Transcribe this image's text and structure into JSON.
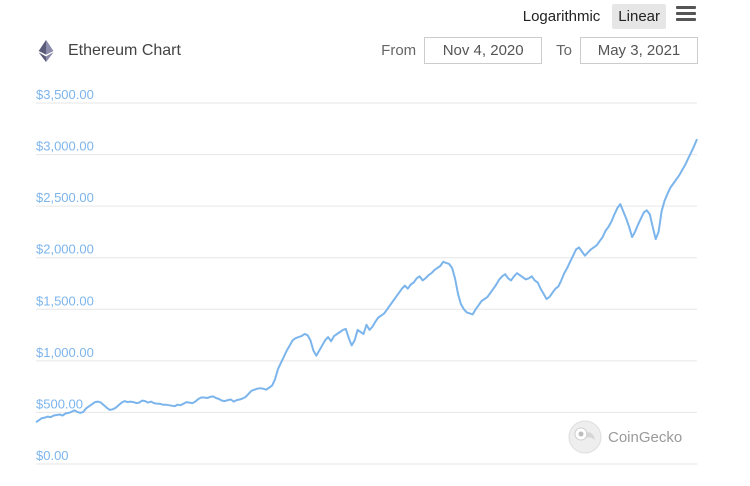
{
  "toolbar": {
    "logarithmic_label": "Logarithmic",
    "linear_label": "Linear",
    "active_scale": "Linear",
    "menu_icon": "hamburger-menu-icon"
  },
  "header": {
    "title": "Ethereum Chart",
    "icon": "ethereum-icon"
  },
  "range": {
    "from_label": "From",
    "from_value": "Nov 4, 2020",
    "to_label": "To",
    "to_value": "May 3, 2021"
  },
  "watermark": {
    "text": "CoinGecko",
    "icon": "coingecko-icon"
  },
  "colors": {
    "line": "#7cb5ec",
    "axis_text": "#7cb5ec",
    "grid": "#e6e6e6"
  },
  "chart_data": {
    "type": "line",
    "title": "Ethereum Chart",
    "xlabel": "",
    "ylabel": "",
    "ylim": [
      0,
      3500
    ],
    "yticks": [
      0,
      500,
      1000,
      1500,
      2000,
      2500,
      3000,
      3500
    ],
    "ytick_labels": [
      "$0.00",
      "$500.00",
      "$1,000.00",
      "$1,500.00",
      "$2,000.00",
      "$2,500.00",
      "$3,000.00",
      "$3,500.00"
    ],
    "grid": true,
    "x_start": "2020-11-04",
    "x_end": "2021-05-03",
    "series": [
      {
        "values": [
          405,
          425,
          445,
          450,
          460,
          455,
          470,
          475,
          480,
          470,
          490,
          495,
          505,
          520,
          505,
          495,
          505,
          540,
          560,
          580,
          600,
          605,
          595,
          570,
          545,
          525,
          530,
          545,
          570,
          595,
          610,
          600,
          605,
          600,
          590,
          595,
          615,
          610,
          595,
          605,
          590,
          585,
          585,
          575,
          575,
          570,
          565,
          560,
          575,
          570,
          585,
          600,
          595,
          590,
          605,
          630,
          645,
          645,
          640,
          650,
          655,
          640,
          630,
          615,
          610,
          620,
          625,
          605,
          620,
          625,
          635,
          650,
          680,
          710,
          720,
          730,
          735,
          730,
          720,
          740,
          760,
          820,
          920,
          980,
          1040,
          1100,
          1150,
          1200,
          1220,
          1230,
          1240,
          1260,
          1250,
          1200,
          1100,
          1050,
          1100,
          1150,
          1200,
          1230,
          1190,
          1240,
          1260,
          1280,
          1300,
          1310,
          1220,
          1150,
          1200,
          1300,
          1280,
          1260,
          1350,
          1300,
          1330,
          1380,
          1420,
          1440,
          1460,
          1500,
          1540,
          1580,
          1620,
          1660,
          1700,
          1730,
          1700,
          1740,
          1760,
          1800,
          1820,
          1780,
          1800,
          1830,
          1850,
          1880,
          1900,
          1920,
          1960,
          1950,
          1940,
          1900,
          1800,
          1650,
          1550,
          1500,
          1470,
          1460,
          1450,
          1500,
          1540,
          1580,
          1600,
          1620,
          1660,
          1700,
          1740,
          1790,
          1820,
          1840,
          1800,
          1780,
          1820,
          1850,
          1830,
          1810,
          1790,
          1800,
          1820,
          1780,
          1760,
          1700,
          1650,
          1600,
          1620,
          1660,
          1700,
          1720,
          1780,
          1850,
          1900,
          1960,
          2020,
          2080,
          2100,
          2060,
          2020,
          2050,
          2080,
          2100,
          2120,
          2160,
          2200,
          2260,
          2300,
          2350,
          2420,
          2480,
          2520,
          2450,
          2380,
          2300,
          2200,
          2250,
          2320,
          2380,
          2440,
          2460,
          2420,
          2300,
          2180,
          2250,
          2450,
          2550,
          2620,
          2680,
          2720,
          2760,
          2800,
          2850,
          2900,
          2960,
          3020,
          3080,
          3150
        ]
      }
    ]
  }
}
